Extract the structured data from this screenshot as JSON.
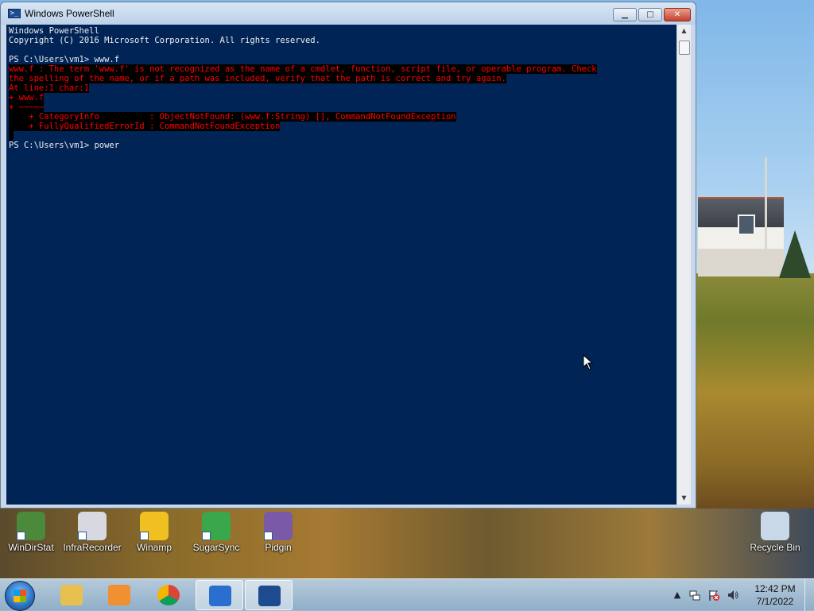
{
  "window": {
    "title": "Windows PowerShell",
    "buttons": {
      "minimize": "▁",
      "maximize": "□",
      "close": "✕"
    }
  },
  "console": {
    "lines": [
      {
        "text": "Windows PowerShell",
        "type": "normal"
      },
      {
        "text": "Copyright (C) 2016 Microsoft Corporation. All rights reserved.",
        "type": "normal"
      },
      {
        "text": "",
        "type": "normal"
      },
      {
        "text": "PS C:\\Users\\vm1> www.f",
        "type": "normal"
      },
      {
        "text": "www.f : The term 'www.f' is not recognized as the name of a cmdlet, function, script file, or operable program. Check",
        "type": "error"
      },
      {
        "text": "the spelling of the name, or if a path was included, verify that the path is correct and try again.",
        "type": "error"
      },
      {
        "text": "At line:1 char:1",
        "type": "error"
      },
      {
        "text": "+ www.f",
        "type": "error"
      },
      {
        "text": "+ ~~~~~",
        "type": "error"
      },
      {
        "text": "    + CategoryInfo          : ObjectNotFound: (www.f:String) [], CommandNotFoundException",
        "type": "error"
      },
      {
        "text": "    + FullyQualifiedErrorId : CommandNotFoundException",
        "type": "error"
      },
      {
        "text": " ",
        "type": "error"
      },
      {
        "text": "PS C:\\Users\\vm1> power",
        "type": "normal"
      }
    ]
  },
  "desktop": {
    "icons": [
      {
        "label": "WinDirStat",
        "icon": "windirstat-icon",
        "color": "#4a8a3a"
      },
      {
        "label": "InfraRecorder",
        "icon": "infrarecorder-icon",
        "color": "#d8d8e0"
      },
      {
        "label": "Winamp",
        "icon": "winamp-icon",
        "color": "#f0c020"
      },
      {
        "label": "SugarSync",
        "icon": "sugarsync-icon",
        "color": "#3aa84a"
      },
      {
        "label": "Pidgin",
        "icon": "pidgin-icon",
        "color": "#7a5aa8"
      },
      {
        "label": "Recycle Bin",
        "icon": "recycle-bin-icon",
        "color": "#c8d8e8"
      }
    ]
  },
  "taskbar": {
    "pinned": [
      {
        "name": "file-explorer",
        "icon": "folder-icon",
        "color": "#e8c050"
      },
      {
        "name": "media-player",
        "icon": "media-player-icon",
        "color": "#f09030"
      },
      {
        "name": "chrome",
        "icon": "chrome-icon",
        "color": "#db4437"
      },
      {
        "name": "app-blue",
        "icon": "blue-app-icon",
        "color": "#2a6fd0"
      },
      {
        "name": "powershell",
        "icon": "powershell-icon",
        "color": "#1e4b8f"
      }
    ],
    "tray": {
      "show_hidden": "▲",
      "time": "12:42 PM",
      "date": "7/1/2022"
    }
  }
}
